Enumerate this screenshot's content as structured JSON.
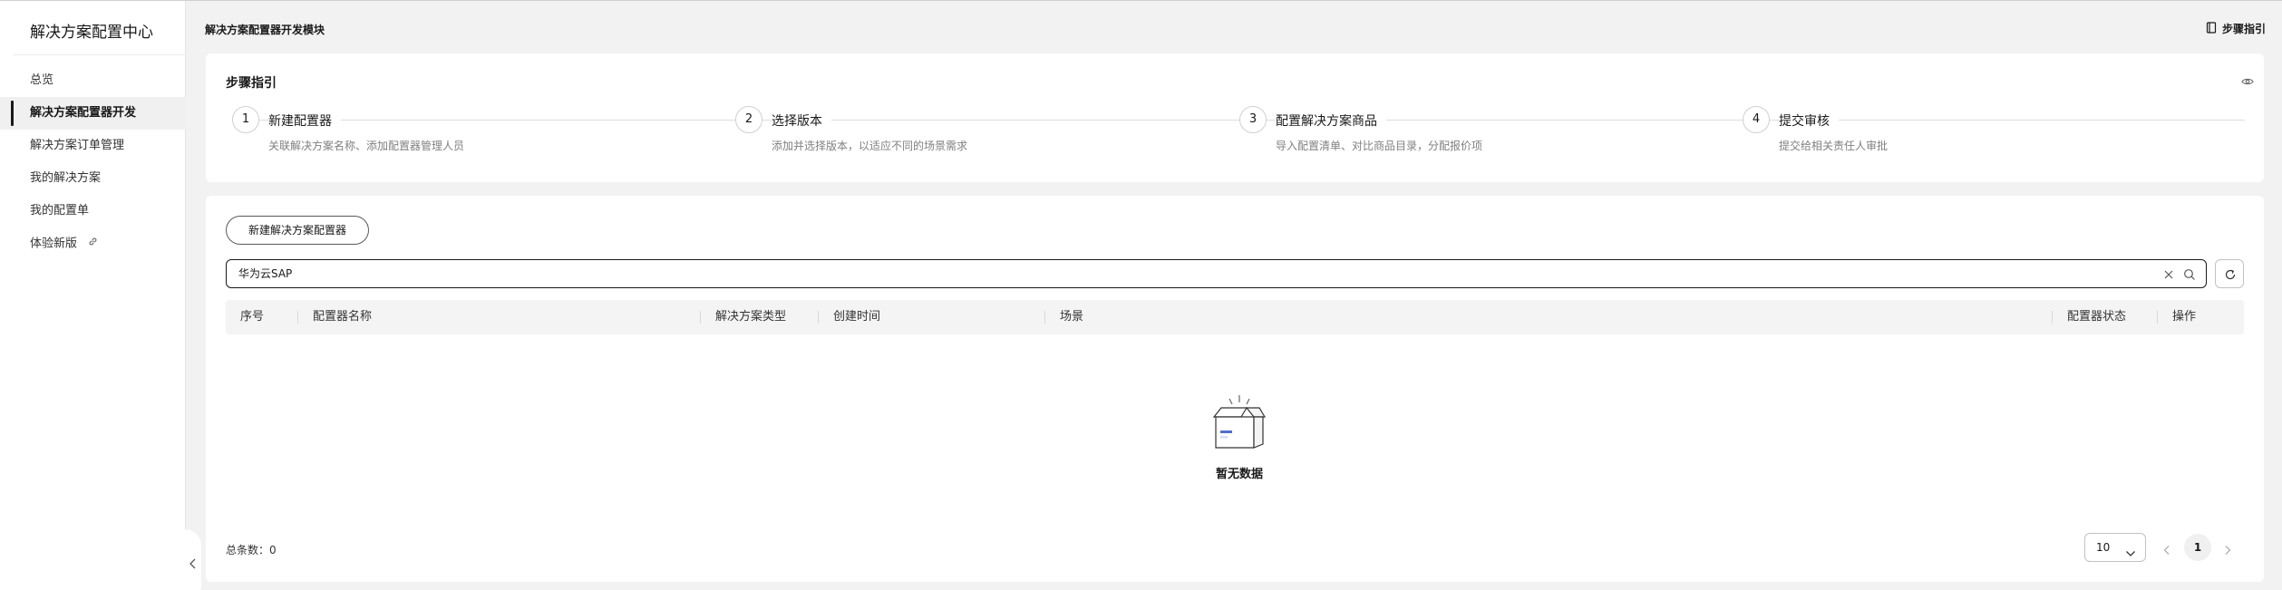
{
  "sidebar": {
    "title": "解决方案配置中心",
    "items": [
      {
        "label": "总览"
      },
      {
        "label": "解决方案配置器开发",
        "active": true
      },
      {
        "label": "解决方案订单管理"
      },
      {
        "label": "我的解决方案"
      },
      {
        "label": "我的配置单"
      },
      {
        "label": "体验新版",
        "icon": "link-icon"
      }
    ],
    "collapse_icon": "chevron-left-icon"
  },
  "header": {
    "title": "解决方案配置器开发模块",
    "guide_label": "步骤指引",
    "guide_icon": "book-icon"
  },
  "steps": {
    "title": "步骤指引",
    "toggle_icon": "eye-icon",
    "items": [
      {
        "number": "1",
        "title": "新建配置器",
        "desc": "关联解决方案名称、添加配置器管理人员"
      },
      {
        "number": "2",
        "title": "选择版本",
        "desc": "添加并选择版本，以适应不同的场景需求"
      },
      {
        "number": "3",
        "title": "配置解决方案商品",
        "desc": "导入配置清单、对比商品目录，分配报价项"
      },
      {
        "number": "4",
        "title": "提交审核",
        "desc": "提交给相关责任人审批"
      }
    ]
  },
  "toolbar": {
    "create_label": "新建解决方案配置器"
  },
  "search": {
    "value": "华为云SAP",
    "clear_icon": "close-icon",
    "search_icon": "search-icon",
    "refresh_icon": "refresh-icon"
  },
  "table": {
    "columns": [
      "序号",
      "配置器名称",
      "解决方案类型",
      "创建时间",
      "场景",
      "配置器状态",
      "操作"
    ],
    "rows": [],
    "empty_text": "暂无数据",
    "empty_icon": "empty-box-icon"
  },
  "pagination": {
    "total_label": "总条数：0",
    "page_size": "10",
    "current_page": "1",
    "prev_icon": "chevron-left-icon",
    "next_icon": "chevron-right-icon"
  },
  "colors": {
    "background": "#f2f2f2",
    "accent": "#191919",
    "empty_icon_blue": "#526ecc"
  }
}
